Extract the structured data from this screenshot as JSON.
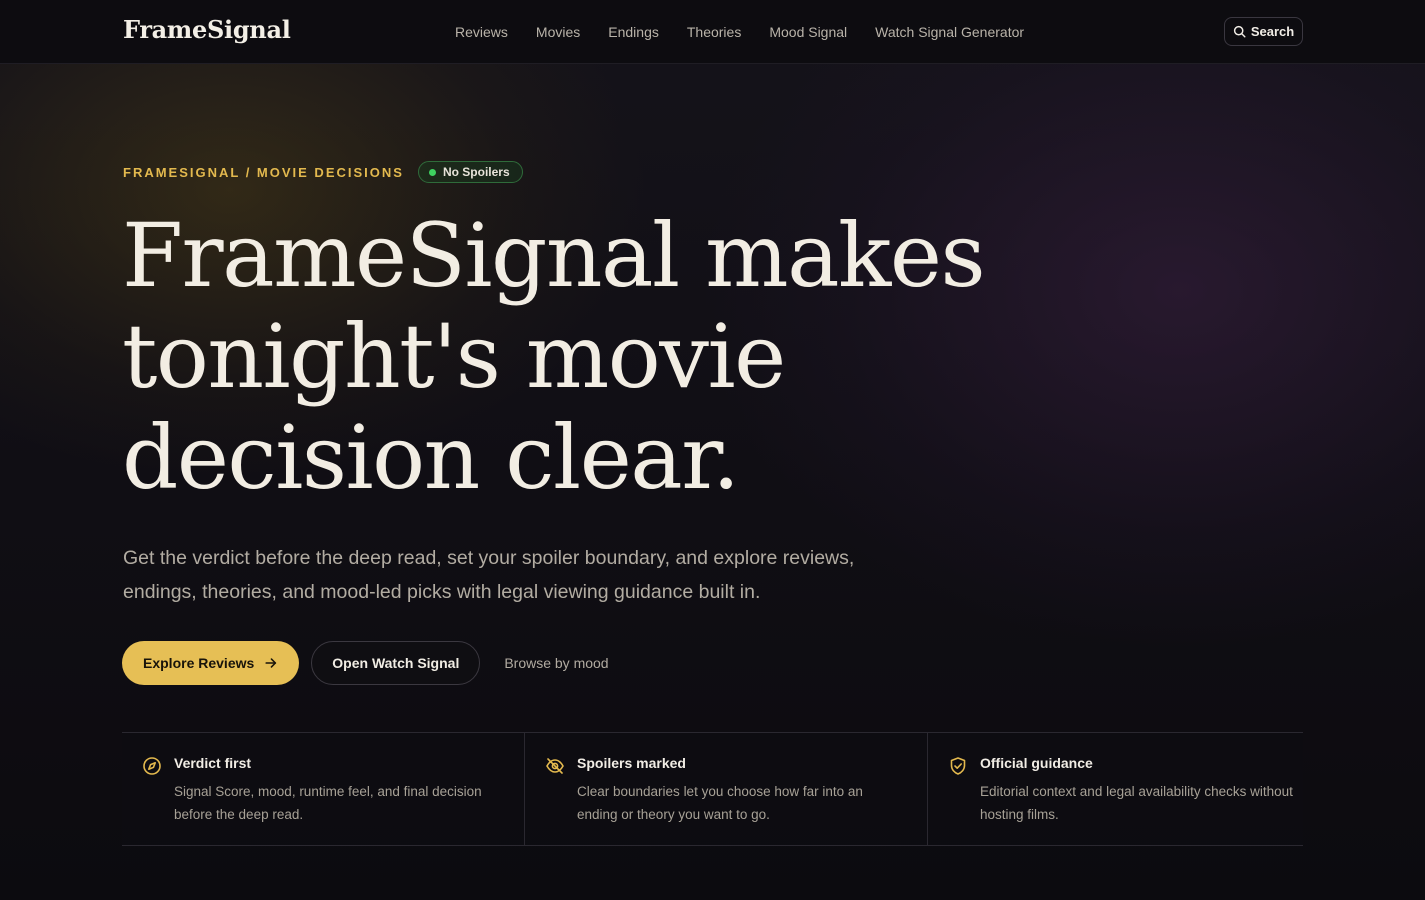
{
  "nav": {
    "brand": "FrameSignal",
    "links": [
      "Reviews",
      "Movies",
      "Endings",
      "Theories",
      "Mood Signal",
      "Watch Signal Generator"
    ],
    "search_label": "Search",
    "search_icon": "search-icon"
  },
  "hero": {
    "eyebrow": "FRAMESIGNAL / MOVIE DECISIONS",
    "badge": "No Spoilers",
    "headline": "FrameSignal makes tonight's movie decision clear.",
    "subtext": "Get the verdict before the deep read, set your spoiler boundary, and explore reviews, endings, theories, and mood-led picks with legal viewing guidance built in.",
    "primary_cta": "Explore Reviews",
    "secondary_cta": "Open Watch Signal",
    "tertiary_cta": "Browse by mood"
  },
  "features": [
    {
      "icon": "compass-icon",
      "title": "Verdict first",
      "text": "Signal Score, mood, runtime feel, and final decision before the deep read."
    },
    {
      "icon": "eye-off-icon",
      "title": "Spoilers marked",
      "text": "Clear boundaries let you choose how far into an ending or theory you want to go."
    },
    {
      "icon": "shield-check-icon",
      "title": "Official guidance",
      "text": "Editorial context and legal availability checks without hosting films."
    }
  ],
  "colors": {
    "accent": "#e6bf55",
    "eyebrow": "#e3b94e",
    "badge_dot": "#3fd160",
    "background": "#0b0a0d"
  }
}
